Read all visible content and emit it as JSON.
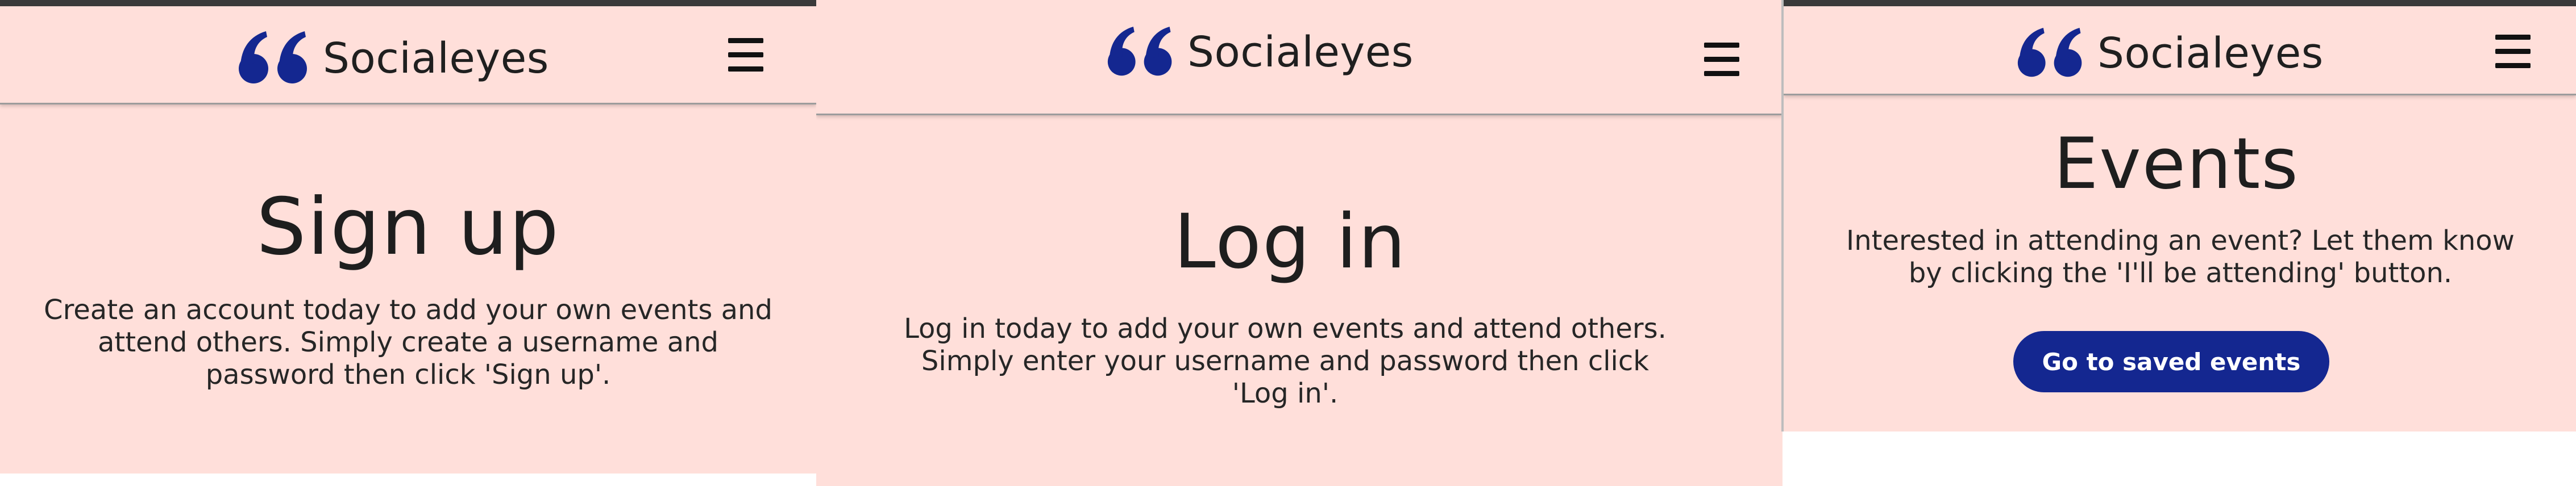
{
  "brand": {
    "name": "Socialeyes",
    "logo_icon": "double-quote-icon",
    "logo_color": "#142790"
  },
  "menu_icon": "hamburger-menu-icon",
  "signup": {
    "title": "Sign up",
    "description": "Create an account today to add your own events and attend others. Simply create a username and password then click 'Sign up'."
  },
  "login": {
    "title": "Log in",
    "description": "Log in today to add your own events and attend others. Simply enter your username and password then click 'Log in'."
  },
  "events": {
    "title": "Events",
    "description": "Interested in attending an event? Let them know by clicking the 'I'll be attending' button.",
    "button_label": "Go to saved events",
    "button_color": "#142790"
  },
  "colors": {
    "page_background": "#ffdfda",
    "text": "#1e1e1e"
  }
}
